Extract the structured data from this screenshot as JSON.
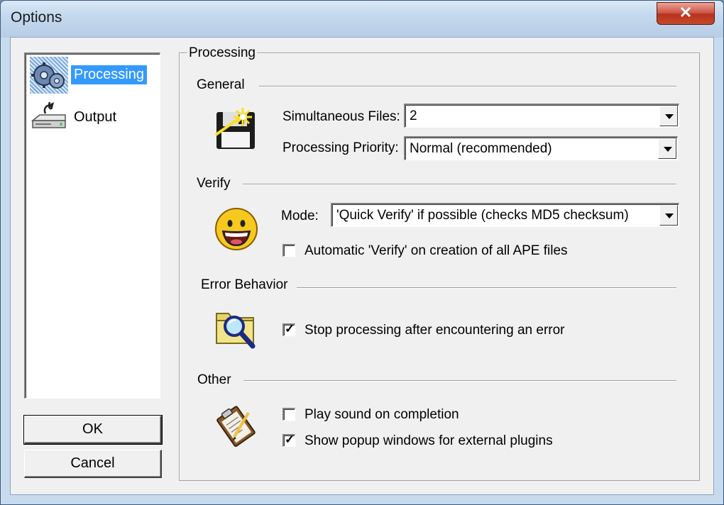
{
  "window": {
    "title": "Options",
    "close_label": "✕"
  },
  "nav": {
    "items": [
      {
        "label": "Processing",
        "icon": "processing-icon",
        "selected": true
      },
      {
        "label": "Output",
        "icon": "output-icon",
        "selected": false
      }
    ]
  },
  "buttons": {
    "ok": "OK",
    "cancel": "Cancel"
  },
  "panel": {
    "title": "Processing",
    "general": {
      "heading": "General",
      "simultaneous_files_label": "Simultaneous Files:",
      "simultaneous_files_value": "2",
      "priority_label": "Processing Priority:",
      "priority_value": "Normal (recommended)"
    },
    "verify": {
      "heading": "Verify",
      "mode_label": "Mode:",
      "mode_value": "'Quick Verify' if possible (checks MD5 checksum)",
      "auto_verify_label": "Automatic 'Verify' on creation of all APE files",
      "auto_verify_checked": false
    },
    "error_behavior": {
      "heading": "Error Behavior",
      "stop_label": "Stop processing after encountering an error",
      "stop_checked": true
    },
    "other": {
      "heading": "Other",
      "play_sound_label": "Play sound on completion",
      "play_sound_checked": false,
      "show_popup_label": "Show popup windows for external plugins",
      "show_popup_checked": true
    }
  },
  "colors": {
    "selection": "#3399ff",
    "dialog_bg": "#f0f0f0",
    "close_red": "#c54a2c"
  }
}
